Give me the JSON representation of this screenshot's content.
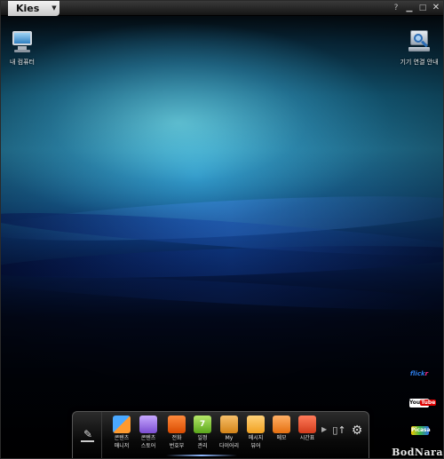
{
  "window": {
    "app_title": "Kies",
    "title_menu_icon": "chevron-down-icon",
    "controls": [
      "help-icon",
      "minimize-icon",
      "maximize-icon",
      "close-icon"
    ]
  },
  "desktop": {
    "icons": [
      {
        "label": "내 컴퓨터",
        "icon": "computer-icon"
      },
      {
        "label": "기기 연결 안내",
        "icon": "device-guide-icon"
      }
    ],
    "social": {
      "flickr_a": "flick",
      "flickr_b": "r",
      "youtube_a": "You",
      "youtube_b": "Tube",
      "picasa": "Picasa"
    }
  },
  "dock": {
    "items": [
      {
        "line1": "콘텐츠",
        "line2": "매니저",
        "icon": "content-manager-icon"
      },
      {
        "line1": "콘텐츠",
        "line2": "스토어",
        "icon": "content-store-icon"
      },
      {
        "line1": "전화",
        "line2": "번호부",
        "icon": "phonebook-icon"
      },
      {
        "line1": "일정",
        "line2": "관리",
        "icon": "schedule-icon",
        "glyph": "7"
      },
      {
        "line1": "My",
        "line2": "다이어리",
        "icon": "diary-icon"
      },
      {
        "line1": "메시지",
        "line2": "뷰어",
        "icon": "message-viewer-icon"
      },
      {
        "line1": "메모",
        "line2": "",
        "icon": "memo-icon"
      },
      {
        "line1": "시간표",
        "line2": "",
        "icon": "timetable-icon"
      }
    ]
  },
  "watermark": "BodNara"
}
